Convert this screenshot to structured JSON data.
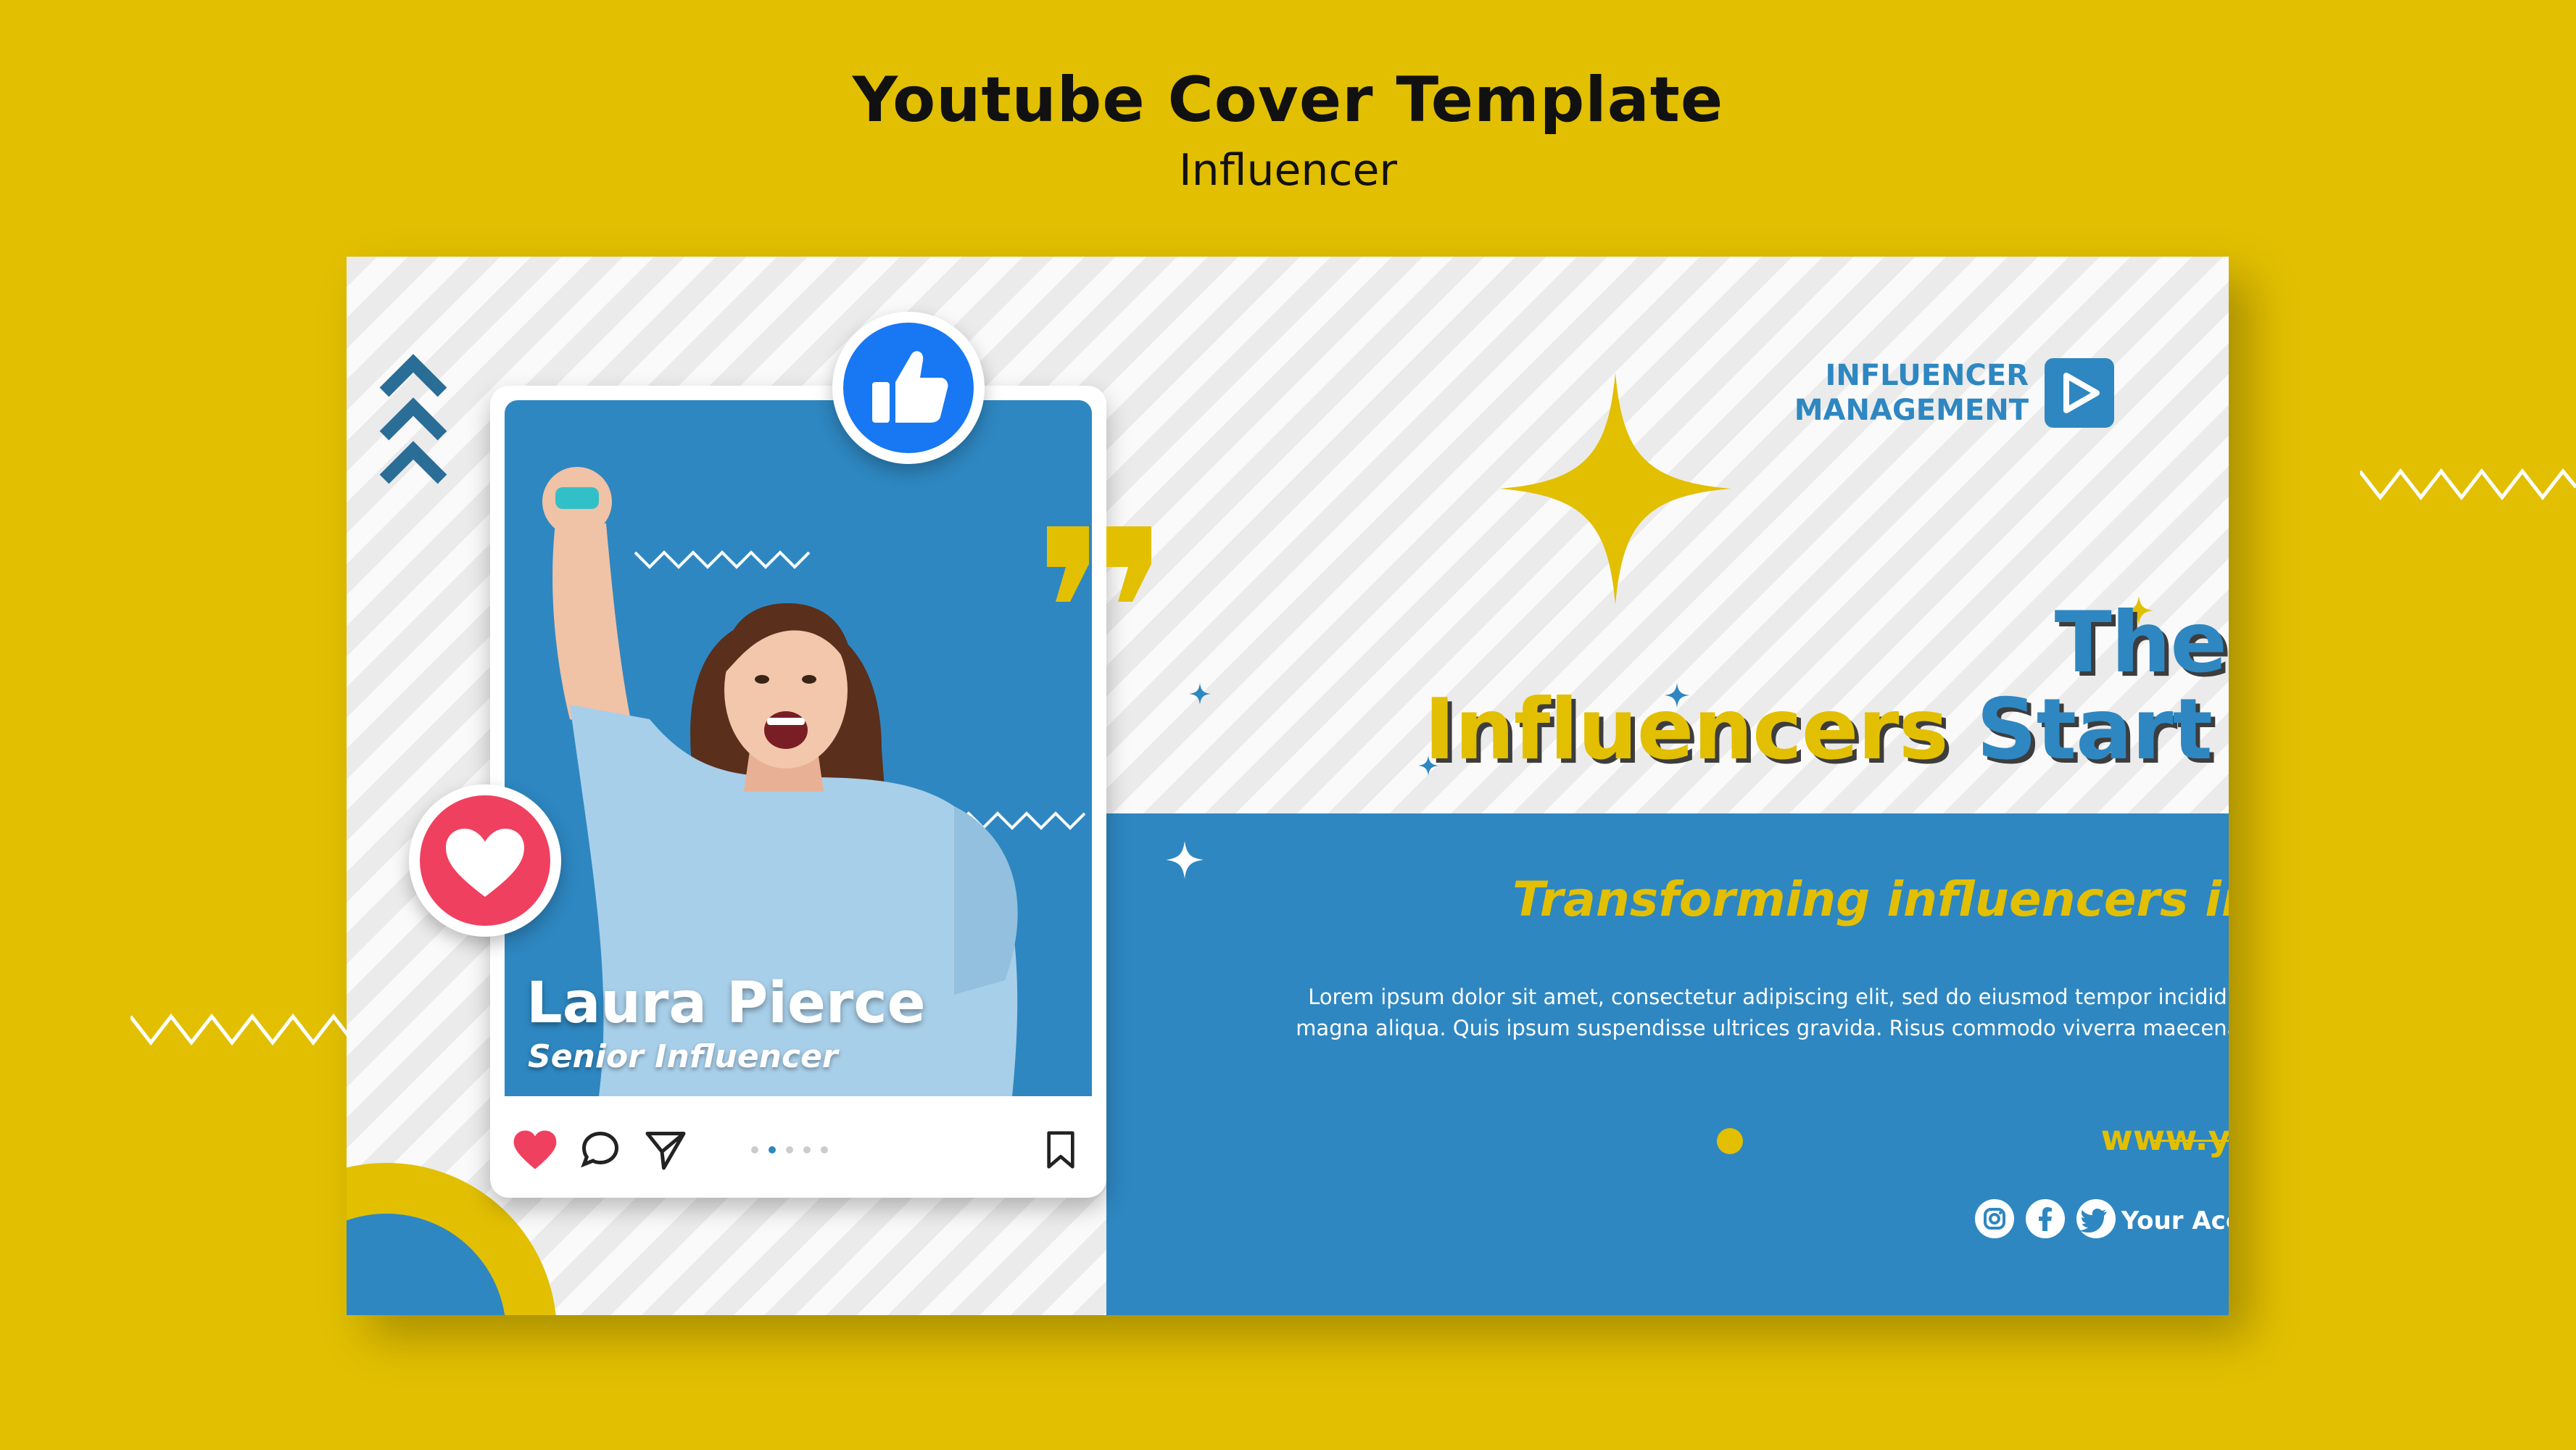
{
  "header": {
    "title": "Youtube Cover Template",
    "subtitle": "Influencer"
  },
  "cover": {
    "brand": {
      "line1": "INFLUENCER",
      "line2": "MANAGEMENT",
      "logo_icon": "play-icon"
    },
    "headline": {
      "line1": "The Best",
      "line2_highlight": "Influencers",
      "line2_rest": "Start Here"
    },
    "tagline": "Transforming influencers into stars",
    "body": "Lorem ipsum dolor sit amet, consectetur adipiscing elit, sed do eiusmod tempor incididunt ut labore et dolore magna aliqua. Quis ipsum suspendisse ultrices gravida. Risus commodo viverra maecenas accumsan lacus vel facilisis.",
    "website": "www.yoursite.com",
    "account_label": "Your Account",
    "social_icons": [
      "instagram-icon",
      "facebook-icon",
      "twitter-icon"
    ],
    "profile": {
      "name": "Laura Pierce",
      "role": "Senior Influencer"
    },
    "post_actions": [
      "heart-icon",
      "comment-icon",
      "share-icon",
      "bookmark-icon"
    ]
  },
  "colors": {
    "background_yellow": "#e2bf00",
    "brand_blue": "#2e87c1",
    "like_blue": "#1877f2",
    "heart_red": "#f0405f",
    "white": "#ffffff"
  }
}
